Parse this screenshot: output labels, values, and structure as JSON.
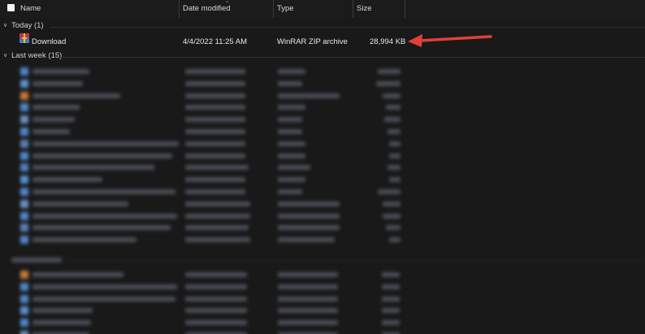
{
  "columns": {
    "name": "Name",
    "date_modified": "Date modified",
    "type": "Type",
    "size": "Size"
  },
  "groups": {
    "today": "Today (1)",
    "last_week": "Last week (15)"
  },
  "files": [
    {
      "name": "Download",
      "date_modified": "4/4/2022 11:25 AM",
      "type": "WinRAR ZIP archive",
      "size": "28,994 KB",
      "icon": "winrar-archive-icon"
    }
  ],
  "colors": {
    "background": "#191919",
    "annotation_arrow": "#e0403a"
  }
}
